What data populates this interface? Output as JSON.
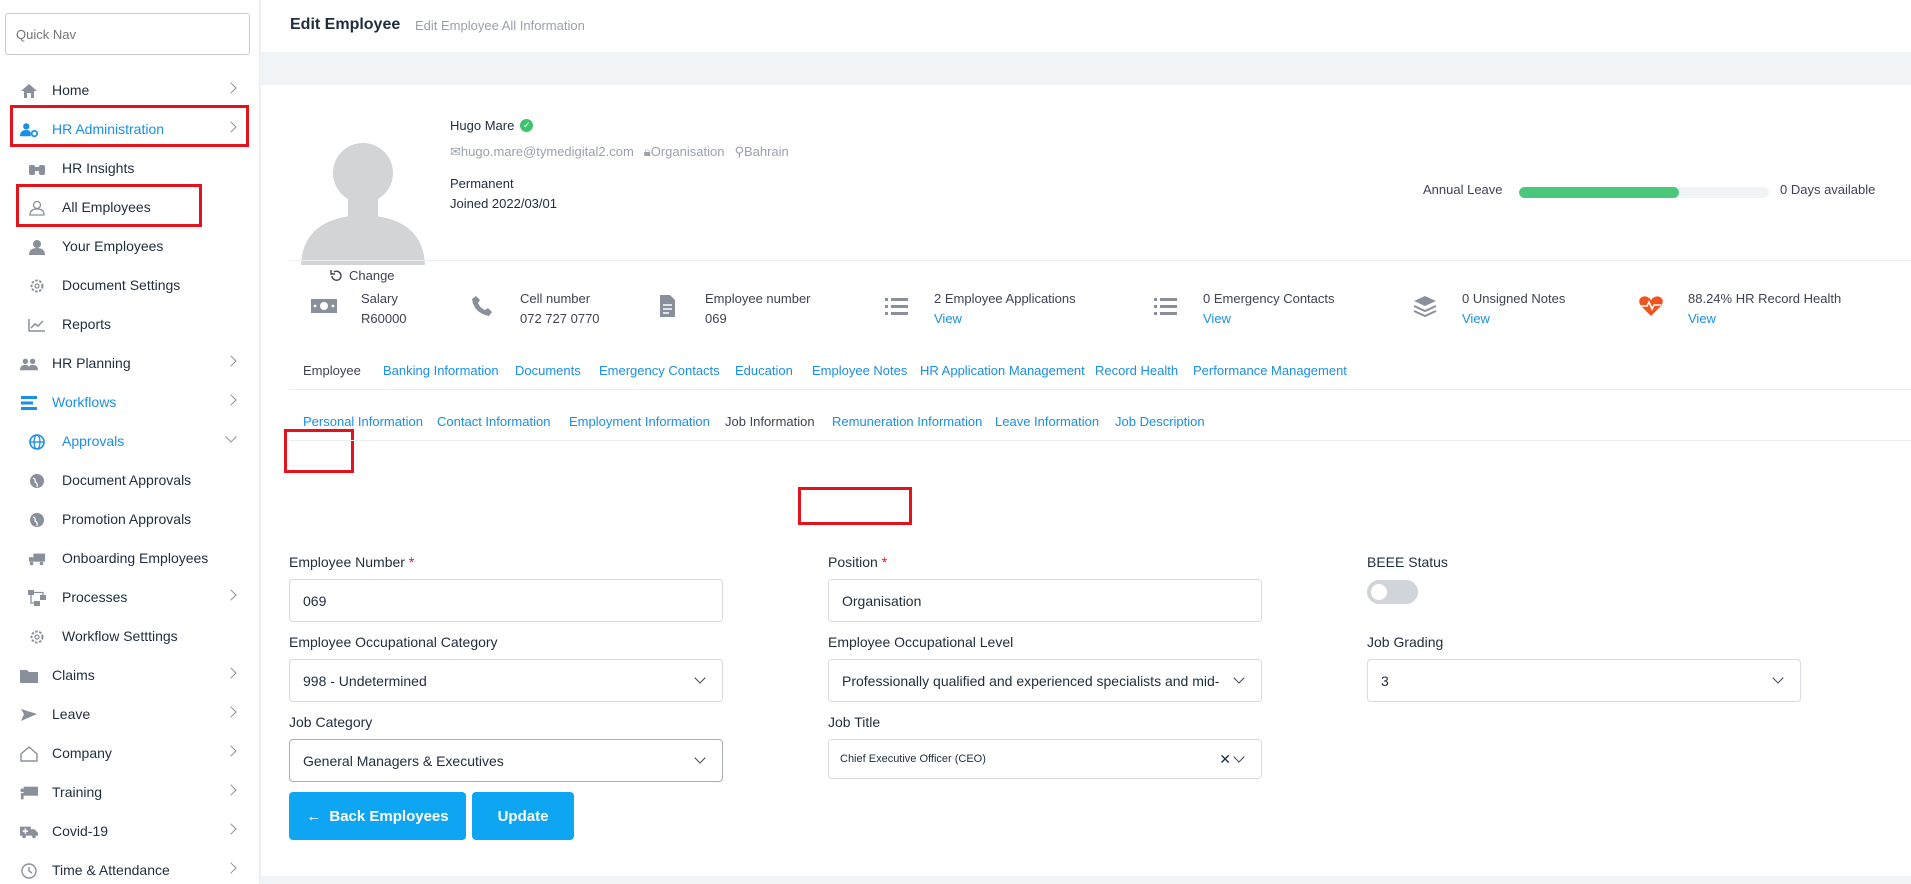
{
  "quicknav": {
    "placeholder": "Quick Nav"
  },
  "sidebar": {
    "items": [
      {
        "label": "Home",
        "icon": "home-icon"
      },
      {
        "label": "HR Administration",
        "icon": "users-cog-icon"
      },
      {
        "label": "HR Insights",
        "icon": "binoculars-icon"
      },
      {
        "label": "All Employees",
        "icon": "people-outline-icon"
      },
      {
        "label": "Your Employees",
        "icon": "user-icon"
      },
      {
        "label": "Document Settings",
        "icon": "gear-icon"
      },
      {
        "label": "Reports",
        "icon": "chart-line-icon"
      },
      {
        "label": "HR Planning",
        "icon": "people-icon"
      },
      {
        "label": "Workflows",
        "icon": "bars-icon"
      },
      {
        "label": "Approvals",
        "icon": "globe-icon"
      },
      {
        "label": "Document Approvals",
        "icon": "globe-icon"
      },
      {
        "label": "Promotion Approvals",
        "icon": "globe-icon"
      },
      {
        "label": "Onboarding Employees",
        "icon": "truck-icon"
      },
      {
        "label": "Processes",
        "icon": "flow-icon"
      },
      {
        "label": "Workflow Setttings",
        "icon": "gear-icon"
      },
      {
        "label": "Claims",
        "icon": "folder-icon"
      },
      {
        "label": "Leave",
        "icon": "plane-icon"
      },
      {
        "label": "Company",
        "icon": "house-outline-icon"
      },
      {
        "label": "Training",
        "icon": "chalkboard-icon"
      },
      {
        "label": "Covid-19",
        "icon": "ambulance-icon"
      },
      {
        "label": "Time & Attendance",
        "icon": "clock-icon"
      }
    ]
  },
  "header": {
    "title": "Edit Employee",
    "subtitle": "Edit Employee All Information"
  },
  "profile": {
    "name": "Hugo Mare",
    "email": "hugo.mare@tymedigital2.com",
    "organisation": "Organisation",
    "location": "Bahrain",
    "type": "Permanent",
    "joined": "Joined 2022/03/01",
    "change_label": "Change",
    "leave_label": "Annual Leave",
    "leave_fill_pct": 64,
    "leave_available": "0 Days available"
  },
  "stats": [
    {
      "title": "Salary",
      "value": "R60000"
    },
    {
      "title": "Cell number",
      "value": "072 727 0770"
    },
    {
      "title": "Employee number",
      "value": "069"
    },
    {
      "title": "2 Employee Applications",
      "value": "View"
    },
    {
      "title": "0 Emergency Contacts",
      "value": "View"
    },
    {
      "title": "0 Unsigned Notes",
      "value": "View"
    },
    {
      "title": "88.24% HR Record Health",
      "value": "View"
    }
  ],
  "main_tabs": [
    "Employee",
    "Banking Information",
    "Documents",
    "Emergency Contacts",
    "Education",
    "Employee Notes",
    "HR Application Management",
    "Record Health",
    "Performance Management"
  ],
  "sub_tabs": [
    "Personal Information",
    "Contact Information",
    "Employment Information",
    "Job Information",
    "Remuneration Information",
    "Leave Information",
    "Job Description"
  ],
  "form": {
    "employee_number_label": "Employee Number",
    "employee_number": "069",
    "position_label": "Position",
    "position": "Organisation",
    "beee_label": "BEEE Status",
    "occ_category_label": "Employee Occupational Category",
    "occ_category": "998 - Undetermined",
    "occ_level_label": "Employee Occupational Level",
    "occ_level": "Professionally qualified and experienced specialists and mid-management",
    "job_grading_label": "Job Grading",
    "job_grading": "3",
    "job_category_label": "Job Category",
    "job_category": "General Managers & Executives",
    "job_title_label": "Job Title",
    "job_title": "Chief Executive Officer (CEO)",
    "required_mark": "*"
  },
  "buttons": {
    "back": "Back Employees",
    "update": "Update"
  },
  "colors": {
    "accent": "#1a8fe3",
    "button": "#0ea5f3",
    "highlight": "#e3131e",
    "leave": "#4bc77b"
  }
}
